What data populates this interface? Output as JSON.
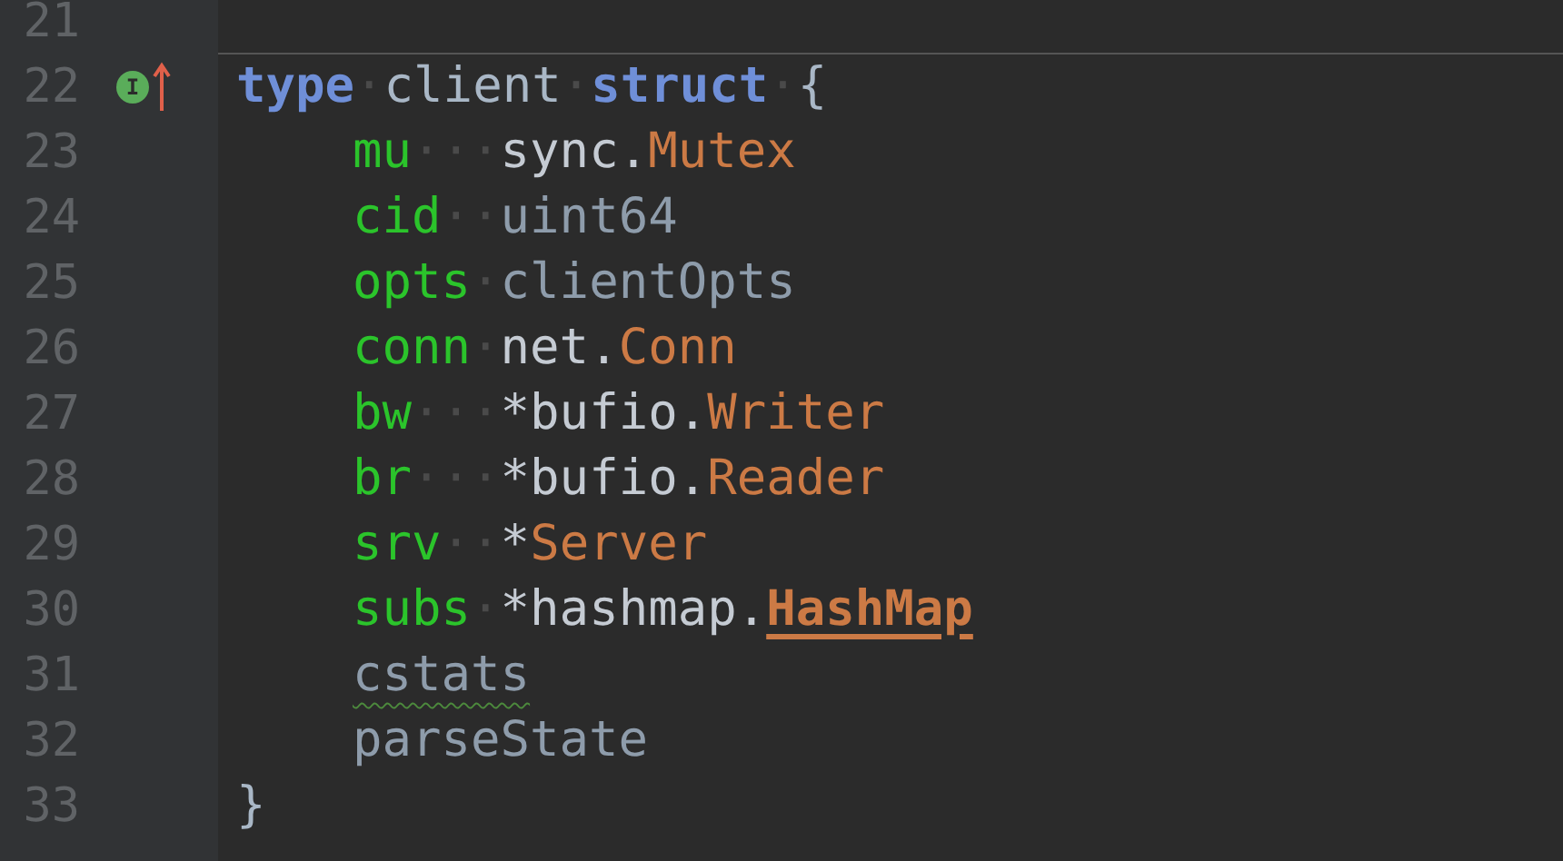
{
  "editor": {
    "lines": [
      {
        "number": "21",
        "separator_after": true
      },
      {
        "number": "22",
        "gutter_marker": {
          "letter": "I"
        },
        "tokens": [
          {
            "kind": "keyword",
            "text": "type"
          },
          {
            "kind": "ws",
            "text": "·"
          },
          {
            "kind": "plain",
            "text": "client"
          },
          {
            "kind": "ws",
            "text": "·"
          },
          {
            "kind": "keyword",
            "text": "struct"
          },
          {
            "kind": "ws",
            "text": "·"
          },
          {
            "kind": "plain",
            "text": "{"
          }
        ],
        "children": [
          {
            "number": "23",
            "tokens": [
              {
                "kind": "field",
                "text": "mu"
              },
              {
                "kind": "ws",
                "text": "···"
              },
              {
                "kind": "package",
                "text": "sync."
              },
              {
                "kind": "type",
                "text": "Mutex"
              }
            ]
          },
          {
            "number": "24",
            "tokens": [
              {
                "kind": "field",
                "text": "cid"
              },
              {
                "kind": "ws",
                "text": "··"
              },
              {
                "kind": "builtin",
                "text": "uint64"
              }
            ]
          },
          {
            "number": "25",
            "tokens": [
              {
                "kind": "field",
                "text": "opts"
              },
              {
                "kind": "ws",
                "text": "·"
              },
              {
                "kind": "builtin",
                "text": "clientOpts"
              }
            ]
          },
          {
            "number": "26",
            "tokens": [
              {
                "kind": "field",
                "text": "conn"
              },
              {
                "kind": "ws",
                "text": "·"
              },
              {
                "kind": "package",
                "text": "net."
              },
              {
                "kind": "type",
                "text": "Conn"
              }
            ]
          },
          {
            "number": "27",
            "tokens": [
              {
                "kind": "field",
                "text": "bw"
              },
              {
                "kind": "ws",
                "text": "···"
              },
              {
                "kind": "package",
                "text": "*bufio."
              },
              {
                "kind": "type",
                "text": "Writer"
              }
            ]
          },
          {
            "number": "28",
            "tokens": [
              {
                "kind": "field",
                "text": "br"
              },
              {
                "kind": "ws",
                "text": "···"
              },
              {
                "kind": "package",
                "text": "*bufio."
              },
              {
                "kind": "type",
                "text": "Reader"
              }
            ]
          },
          {
            "number": "29",
            "tokens": [
              {
                "kind": "field",
                "text": "srv"
              },
              {
                "kind": "ws",
                "text": "··"
              },
              {
                "kind": "package",
                "text": "*"
              },
              {
                "kind": "type",
                "text": "Server"
              }
            ]
          },
          {
            "number": "30",
            "tokens": [
              {
                "kind": "field",
                "text": "subs"
              },
              {
                "kind": "ws",
                "text": "·"
              },
              {
                "kind": "package",
                "text": "*hashmap."
              },
              {
                "kind": "link",
                "text": "HashMap"
              }
            ]
          },
          {
            "number": "31",
            "tokens": [
              {
                "kind": "warning",
                "text": "cstats"
              }
            ]
          },
          {
            "number": "32",
            "tokens": [
              {
                "kind": "builtin",
                "text": "parseState"
              }
            ]
          }
        ]
      },
      {
        "number": "33",
        "tokens": [
          {
            "kind": "plain",
            "text": "}"
          }
        ]
      }
    ]
  }
}
